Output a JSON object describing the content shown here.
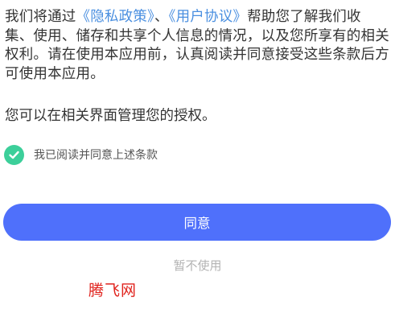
{
  "notice": {
    "intro": "我们将通过",
    "privacy_link": "《隐私政策》",
    "separator": "、",
    "terms_link": "《用户协议》",
    "body": "帮助您了解我们收集、使用、储存和共享个人信息的情况，以及您所享有的相关权利。请在使用本应用前，认真阅读并同意接受这些条款后方可使用本应用。",
    "manage_text": "您可以在相关界面管理您的授权。"
  },
  "consent": {
    "checked": true,
    "label": "我已阅读并同意上述条款",
    "check_color": "#3ccf9a"
  },
  "actions": {
    "agree_label": "同意",
    "decline_label": "暂不使用",
    "agree_color": "#4f70fb"
  },
  "watermark": {
    "text": "腾飞网"
  },
  "colors": {
    "link": "#4a8fe0",
    "text": "#333333",
    "watermark": "#e0221c"
  }
}
